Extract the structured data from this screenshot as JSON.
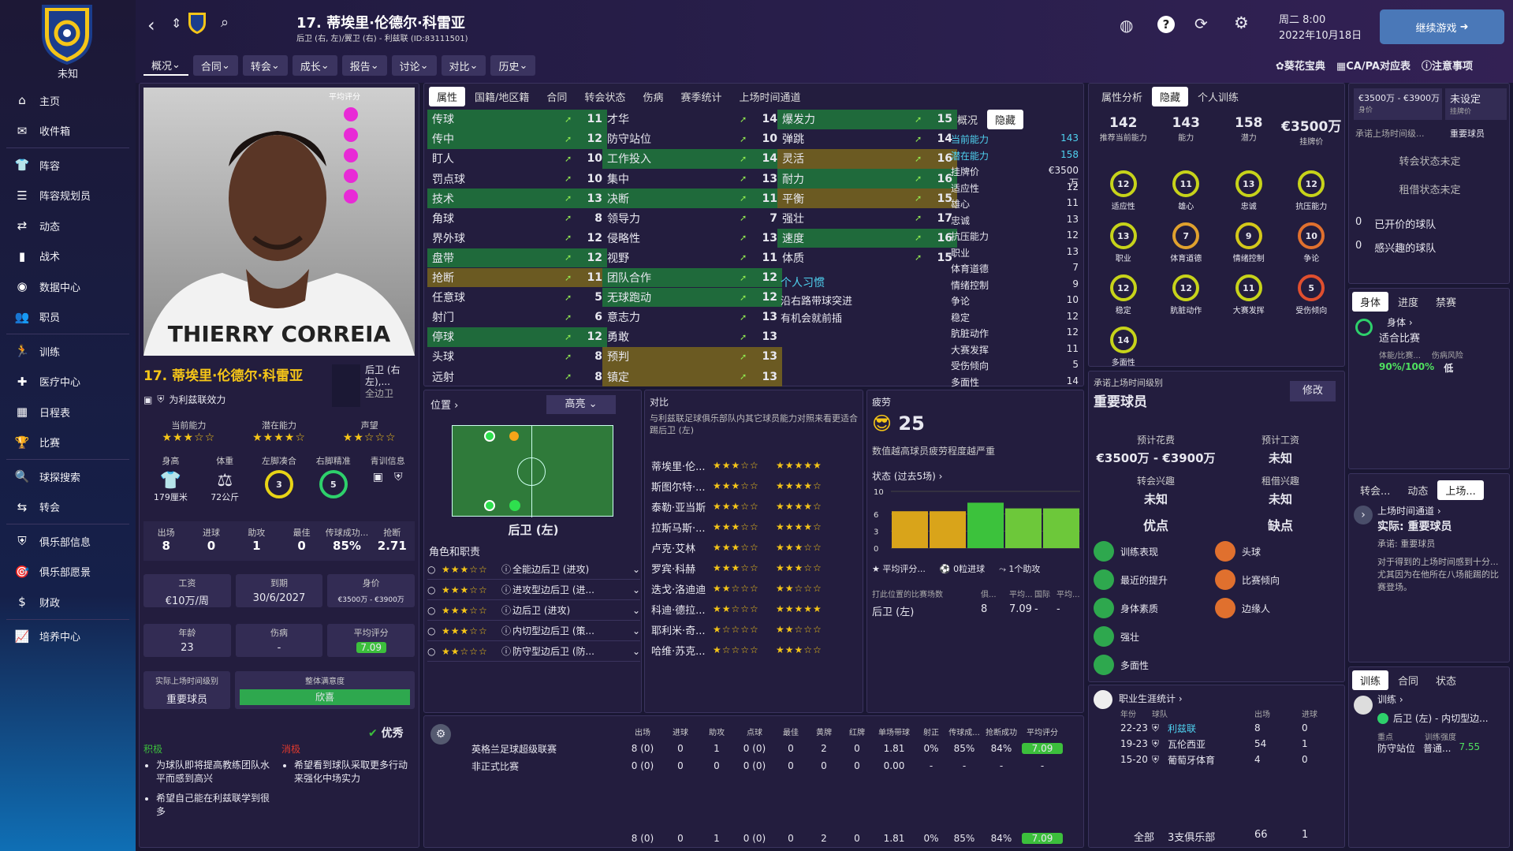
{
  "club": {
    "name": "未知"
  },
  "nav": [
    "主页",
    "收件箱",
    "阵容",
    "阵容规划员",
    "动态",
    "战术",
    "数据中心",
    "职员",
    "训练",
    "医疗中心",
    "日程表",
    "比赛",
    "球探搜索",
    "转会",
    "俱乐部信息",
    "俱乐部愿景",
    "财政",
    "培养中心"
  ],
  "header": {
    "player_title": "17. 蒂埃里·伦德尔·科雷亚",
    "player_sub": "后卫 (右, 左)/翼卫 (右) - 利兹联 (ID:83111501)",
    "date_day": "周二 8:00",
    "date": "2022年10月18日",
    "continue_label": "继续游戏",
    "tabs": [
      "概况",
      "合同",
      "转会",
      "成长",
      "报告",
      "讨论",
      "对比",
      "历史"
    ]
  },
  "top_links": [
    "葵花宝典",
    "CA/PA对应表",
    "注意事项"
  ],
  "profile": {
    "name": "17. 蒂埃里·伦德尔·科雷亚",
    "role": "后卫 (右左),...",
    "role2": "全边卫",
    "plays_for": "为利兹联效力",
    "jersey": "THIERRY CORREIA",
    "ca_label": "当前能力",
    "pa_label": "潜在能力",
    "rep_label": "声望",
    "ca_stars": "★★★☆☆",
    "pa_stars": "★★★★☆",
    "rep_stars": "★★☆☆☆",
    "height_label": "身高",
    "weight_label": "体重",
    "lfoot_label": "左脚凑合",
    "rfoot_label": "右脚精准",
    "youth_label": "青训信息",
    "height": "179厘米",
    "weight": "72公斤",
    "lfoot": "3",
    "rfoot": "5",
    "apps_label": "出场",
    "goals_label": "进球",
    "assists_label": "助攻",
    "best_label": "最佳",
    "pass_label": "传球成功...",
    "tackle_label": "抢断",
    "apps": "8",
    "goals": "0",
    "assists": "1",
    "best": "0",
    "pass": "85%",
    "tackle": "2.71",
    "wage_label": "工资",
    "expiry_label": "到期",
    "value_label": "身价",
    "wage": "€10万/周",
    "expiry": "30/6/2027",
    "value": "€3500万 - €3900万",
    "age_label": "年龄",
    "injury_label": "伤病",
    "avg_label": "平均评分",
    "age": "23",
    "injury": "-",
    "avg": "7.09",
    "playing_time_label": "实际上场时间级别",
    "playing_time": "重要球员",
    "satisfaction_label": "整体满意度",
    "satisfaction": "欣喜",
    "mood": "优秀",
    "rating_label": "平均评分",
    "pos_label": "积极",
    "neg_label": "消极",
    "positives": [
      "为球队即将提高教练团队水平而感到高兴",
      "希望自己能在利兹联学到很多"
    ],
    "negatives": [
      "希望看到球队采取更多行动来强化中场实力"
    ]
  },
  "attr_tabs": [
    "属性",
    "国籍/地区籍",
    "合同",
    "转会状态",
    "伤病",
    "赛季统计",
    "上场时间通道"
  ],
  "attributes": {
    "tech": [
      [
        "传球",
        "11",
        "g"
      ],
      [
        "传中",
        "12",
        "g"
      ],
      [
        "盯人",
        "10",
        ""
      ],
      [
        "罚点球",
        "10",
        ""
      ],
      [
        "技术",
        "13",
        "g"
      ],
      [
        "角球",
        "8",
        ""
      ],
      [
        "界外球",
        "12",
        ""
      ],
      [
        "盘带",
        "12",
        "g"
      ],
      [
        "抢断",
        "11",
        "o"
      ],
      [
        "任意球",
        "5",
        ""
      ],
      [
        "射门",
        "6",
        ""
      ],
      [
        "停球",
        "12",
        "g"
      ],
      [
        "头球",
        "8",
        ""
      ],
      [
        "远射",
        "8",
        ""
      ]
    ],
    "mental": [
      [
        "才华",
        "14",
        ""
      ],
      [
        "防守站位",
        "10",
        ""
      ],
      [
        "工作投入",
        "14",
        "g"
      ],
      [
        "集中",
        "13",
        ""
      ],
      [
        "决断",
        "11",
        "g"
      ],
      [
        "领导力",
        "7",
        ""
      ],
      [
        "侵略性",
        "13",
        ""
      ],
      [
        "视野",
        "11",
        ""
      ],
      [
        "团队合作",
        "12",
        "g"
      ],
      [
        "无球跑动",
        "12",
        "g"
      ],
      [
        "意志力",
        "13",
        ""
      ],
      [
        "勇敢",
        "13",
        ""
      ],
      [
        "预判",
        "13",
        "o"
      ],
      [
        "镇定",
        "13",
        "o"
      ]
    ],
    "phys": [
      [
        "爆发力",
        "15",
        "g"
      ],
      [
        "弹跳",
        "14",
        ""
      ],
      [
        "灵活",
        "16",
        "o"
      ],
      [
        "耐力",
        "16",
        "g"
      ],
      [
        "平衡",
        "15",
        "o"
      ],
      [
        "强壮",
        "17",
        ""
      ],
      [
        "速度",
        "16",
        "g"
      ],
      [
        "体质",
        "15",
        ""
      ]
    ]
  },
  "habits": {
    "title": "个人习惯",
    "items": [
      "沿右路带球突进",
      "有机会就前插"
    ]
  },
  "hidden_tabs": [
    "概况",
    "隐藏"
  ],
  "hidden": [
    [
      "当前能力",
      "143"
    ],
    [
      "潜在能力",
      "158"
    ],
    [
      "挂牌价",
      "€3500万"
    ],
    [
      "适应性",
      "12"
    ],
    [
      "雄心",
      "11"
    ],
    [
      "忠诚",
      "13"
    ],
    [
      "抗压能力",
      "12"
    ],
    [
      "职业",
      "13"
    ],
    [
      "体育道德",
      "7"
    ],
    [
      "情绪控制",
      "9"
    ],
    [
      "争论",
      "10"
    ],
    [
      "稳定",
      "12"
    ],
    [
      "肮脏动作",
      "12"
    ],
    [
      "大赛发挥",
      "11"
    ],
    [
      "受伤倾向",
      "5"
    ],
    [
      "多面性",
      "14"
    ]
  ],
  "position": {
    "title": "位置",
    "highlight": "高亮",
    "pos": "后卫 (左)",
    "roles_title": "角色和职责",
    "roles": [
      [
        "★★★☆☆",
        "全能边后卫 (进攻)"
      ],
      [
        "★★★☆☆",
        "进攻型边后卫 (进..."
      ],
      [
        "★★★☆☆",
        "边后卫 (进攻)"
      ],
      [
        "★★★☆☆",
        "内切型边后卫 (策..."
      ],
      [
        "★★☆☆☆",
        "防守型边后卫 (防..."
      ]
    ]
  },
  "compare": {
    "title": "对比",
    "desc": "与利兹联足球俱乐部队内其它球员能力对照来看更适合踢后卫 (左)",
    "rows": [
      [
        "蒂埃里·伦...",
        "★★★☆☆",
        "★★★★★"
      ],
      [
        "斯图尔特·...",
        "★★★☆☆",
        "★★★★☆"
      ],
      [
        "泰勒·亚当斯",
        "★★★☆☆",
        "★★★★☆"
      ],
      [
        "拉斯马斯·...",
        "★★★☆☆",
        "★★★★☆"
      ],
      [
        "卢克·艾林",
        "★★★☆☆",
        "★★★☆☆"
      ],
      [
        "罗宾·科赫",
        "★★★☆☆",
        "★★★☆☆"
      ],
      [
        "迭戈·洛迪迪",
        "★★☆☆☆",
        "★★☆☆☆"
      ],
      [
        "科迪·德拉...",
        "★★☆☆☆",
        "★★★★★"
      ],
      [
        "耶利米·奇...",
        "★☆☆☆☆",
        "★★☆☆☆"
      ],
      [
        "哈维·苏克...",
        "★☆☆☆☆",
        "★★★☆☆"
      ]
    ]
  },
  "fatigue": {
    "title": "疲劳",
    "value": "25",
    "desc": "数值越高球员疲劳程度越严重",
    "form_title": "状态 (过去5场)",
    "form_values": [
      6.5,
      6.5,
      8,
      7,
      7
    ],
    "yticks": [
      "10",
      "6",
      "3",
      "0"
    ],
    "avg_label": "平均评分...",
    "goals_label": "0粒进球",
    "assists_label": "1个助攻",
    "pos_table_title": "打此位置的比赛场数",
    "cols": [
      "俱...",
      "平均...",
      "国际",
      "平均..."
    ],
    "pos_row": [
      "后卫 (左)",
      "8",
      "7.09",
      "-",
      "-"
    ]
  },
  "stats": {
    "cols": [
      "出场",
      "进球",
      "助攻",
      "点球",
      "最佳",
      "黄牌",
      "红牌",
      "单场带球",
      "射正",
      "传球成...",
      "抢断成功",
      "平均评分"
    ],
    "rows": [
      {
        "name": "英格兰足球超级联赛",
        "v": [
          "8 (0)",
          "0",
          "1",
          "0 (0)",
          "0",
          "2",
          "0",
          "1.81",
          "0%",
          "85%",
          "84%",
          "7.09"
        ]
      },
      {
        "name": "非正式比赛",
        "v": [
          "0 (0)",
          "0",
          "0",
          "0 (0)",
          "0",
          "0",
          "0",
          "0.00",
          "-",
          "-",
          "-",
          "-"
        ]
      }
    ],
    "total": [
      "8 (0)",
      "0",
      "1",
      "0 (0)",
      "0",
      "2",
      "0",
      "1.81",
      "0%",
      "85%",
      "84%",
      "7.09"
    ]
  },
  "analysis": {
    "tabs": [
      "属性分析",
      "隐藏",
      "个人训练"
    ],
    "top": [
      [
        "142",
        "推荐当前能力"
      ],
      [
        "143",
        "能力"
      ],
      [
        "158",
        "潜力"
      ],
      [
        "€3500万",
        "挂牌价"
      ]
    ],
    "gauges": [
      [
        "12",
        "适应性"
      ],
      [
        "11",
        "雄心"
      ],
      [
        "13",
        "忠诚"
      ],
      [
        "12",
        "抗压能力"
      ],
      [
        "13",
        "职业"
      ],
      [
        "7",
        "体育道德"
      ],
      [
        "9",
        "情绪控制"
      ],
      [
        "10",
        "争论"
      ],
      [
        "12",
        "稳定"
      ],
      [
        "12",
        "肮脏动作"
      ],
      [
        "11",
        "大赛发挥"
      ],
      [
        "5",
        "受伤倾向"
      ],
      [
        "14",
        "多面性"
      ]
    ]
  },
  "playtime": {
    "title": "承诺上场时间级别",
    "value": "重要球员",
    "edit": "修改",
    "fee_label": "预计花费",
    "fee": "€3500万 - €3900万",
    "wage_label": "预计工资",
    "wage": "未知",
    "tr_label": "转会兴趣",
    "tr": "未知",
    "loan_label": "租借兴趣",
    "loan": "未知",
    "pros_label": "优点",
    "cons_label": "缺点",
    "pros": [
      "训练表现",
      "最近的提升",
      "身体素质",
      "强壮",
      "多面性"
    ],
    "cons": [
      "头球",
      "比赛倾向",
      "边缘人"
    ]
  },
  "career": {
    "title": "职业生涯统计",
    "h": [
      "年份",
      "球队",
      "出场",
      "进球"
    ],
    "rows": [
      [
        "22-23",
        "利兹联",
        "8",
        "0"
      ],
      [
        "19-23",
        "瓦伦西亚",
        "54",
        "1"
      ],
      [
        "15-20",
        "葡萄牙体育",
        "4",
        "0"
      ]
    ],
    "total": [
      "全部",
      "3支俱乐部",
      "66",
      "1"
    ]
  },
  "right": {
    "value_range": "€3500万 - €3900万",
    "value_label": "身价",
    "unset": "未设定",
    "ask_label": "挂牌价",
    "promise": "承诺上场时间级...",
    "promise_val": "重要球员",
    "tr_status": "转会状态未定",
    "loan_status": "租借状态未定",
    "count1": "0",
    "count1_label": "已开价的球队",
    "count2": "0",
    "count2_label": "感兴趣的球队",
    "body_tabs": [
      "身体",
      "进度",
      "禁赛"
    ],
    "body": "身体",
    "fit": "适合比赛",
    "fitness_label": "体能/比赛...",
    "risk_label": "伤病风险",
    "fitness": "90%/100%",
    "risk": "低",
    "tt_tabs": [
      "转会...",
      "动态",
      "上场..."
    ],
    "tt_title": "上场时间通道",
    "tt_actual": "实际: 重要球员",
    "tt_promise": "承诺: 重要球员",
    "tt_desc": "对于得到的上场时间感到十分...尤其因为在他所在八场能踢的比赛登场。",
    "tr_tabs": [
      "训练",
      "合同",
      "状态"
    ],
    "train_title": "训练",
    "train_pos": "后卫 (左) - 内切型边...",
    "focus_label": "重点",
    "intensity_label": "训练强度",
    "focus": "防守站位",
    "intensity": "普通...",
    "train_rating": "7.55"
  }
}
